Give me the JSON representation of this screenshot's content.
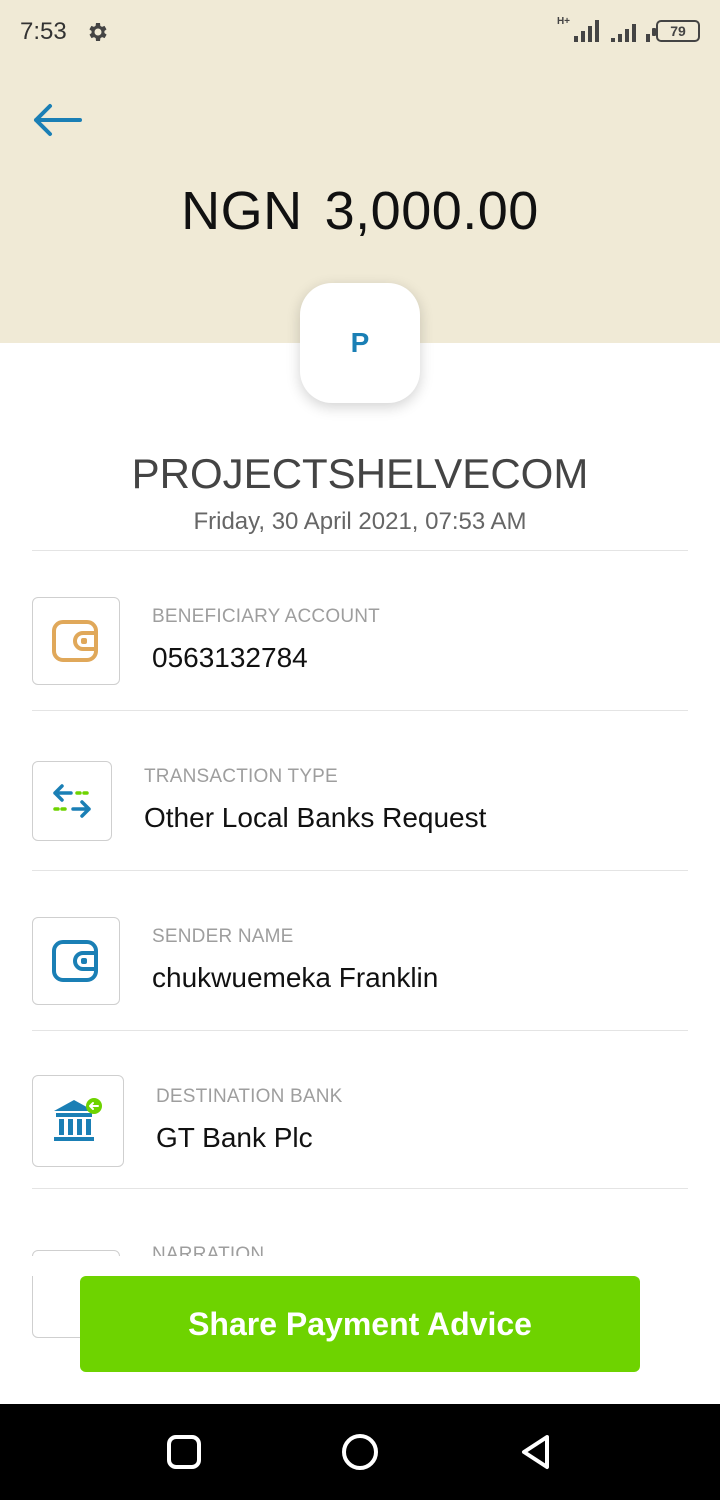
{
  "status_bar": {
    "time": "7:53",
    "network_type": "H+",
    "battery": "79",
    "icons": [
      "gear-icon",
      "signal-icon",
      "battery-icon"
    ]
  },
  "header": {
    "back_icon": "arrow-left-icon",
    "currency": "NGN",
    "amount": "3,000.00",
    "avatar_letter": "P"
  },
  "merchant": {
    "name": "PROJECTSHELVECOM",
    "datetime": "Friday, 30 April 2021, 07:53 AM"
  },
  "details": [
    {
      "label": "BENEFICIARY ACCOUNT",
      "value": "0563132784",
      "icon": "wallet-icon",
      "icon_color": "#e0a85a"
    },
    {
      "label": "TRANSACTION TYPE",
      "value": "Other Local Banks Request",
      "icon": "transfer-arrows-icon",
      "icon_color": "#1a7fb5"
    },
    {
      "label": "SENDER NAME",
      "value": "chukwuemeka Franklin",
      "icon": "wallet-icon",
      "icon_color": "#1a7fb5"
    },
    {
      "label": "DESTINATION BANK",
      "value": "GT Bank Plc",
      "icon": "bank-icon",
      "icon_color": "#1a7fb5"
    },
    {
      "label": "NARRATION",
      "value": "",
      "icon": "note-icon",
      "icon_color": "#1a7fb5"
    }
  ],
  "actions": {
    "share_label": "Share Payment Advice"
  },
  "colors": {
    "header_bg": "#f0ead6",
    "accent_blue": "#1a7fb5",
    "accent_green": "#6ed300",
    "wallet_gold": "#e0a85a"
  },
  "nav_bar": {
    "icons": [
      "square-recents-icon",
      "circle-home-icon",
      "triangle-back-icon"
    ]
  }
}
